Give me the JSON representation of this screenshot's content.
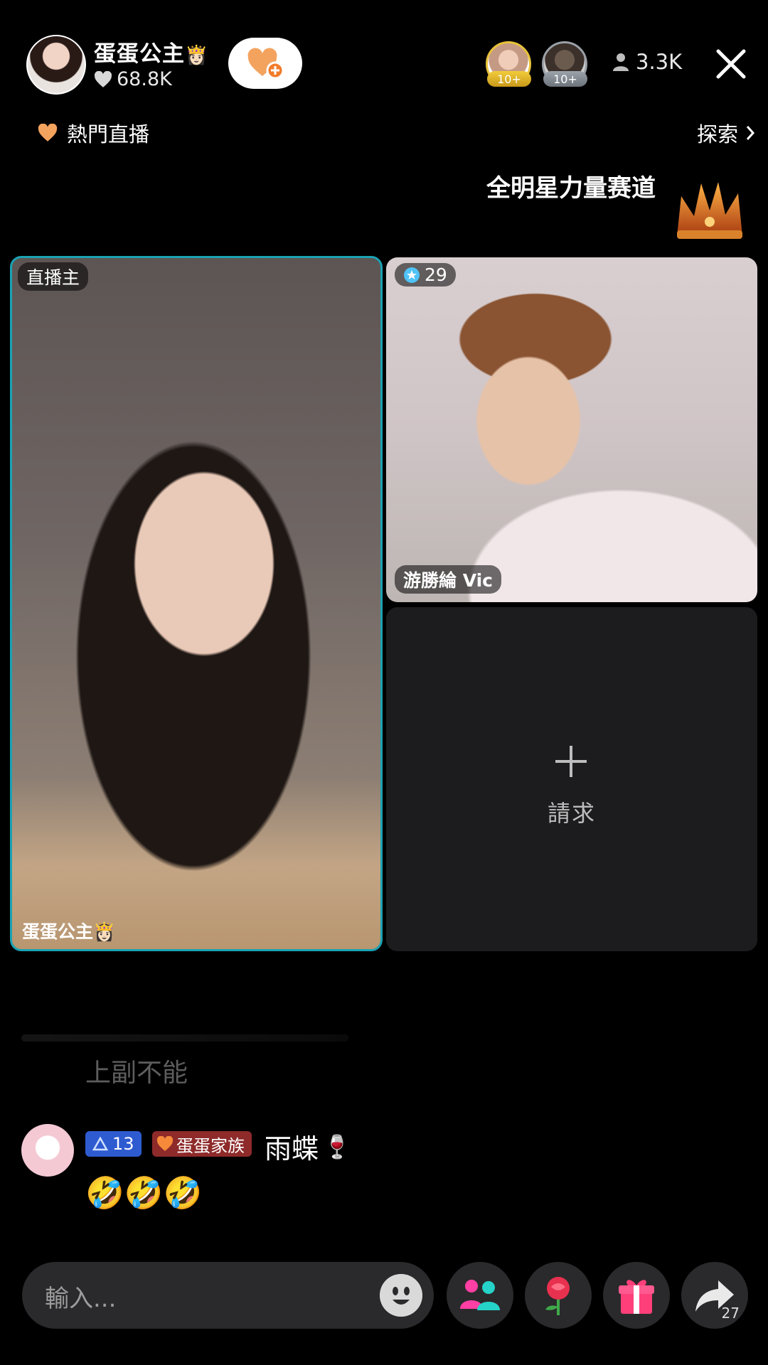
{
  "header": {
    "host_name": "蛋蛋公主",
    "host_emoji": "👸🏻",
    "likes": "68.8K",
    "viewer_badges": [
      "10+",
      "10+"
    ],
    "viewer_count": "3.3K"
  },
  "nav": {
    "hot_live": "熱門直播",
    "explore": "探索"
  },
  "event": {
    "title": "全明星力量赛道"
  },
  "tiles": {
    "host_tag": "直播主",
    "host_name": "蛋蛋公主👸🏻",
    "guest_score": "29",
    "guest_name": "游勝綸 Vic",
    "request_label": "請求"
  },
  "chat": {
    "faded_message": "上副不能",
    "level": "13",
    "family": "蛋蛋家族",
    "username": "雨蝶",
    "username_emoji": "🍷",
    "message": "🤣🤣🤣"
  },
  "bottom": {
    "input_placeholder": "輸入...",
    "share_count": "27"
  },
  "colors": {
    "host_border": "#1aa2b3",
    "level_badge": "#2f5bd1",
    "family_badge": "#8e2a2a",
    "follow_heart": "#f4a35f"
  },
  "icons": [
    "heart-icon",
    "person-icon",
    "close-icon",
    "chevron-right-icon",
    "crown-icon",
    "plus-icon",
    "emoji-icon",
    "multi-guest-icon",
    "rose-icon",
    "gift-icon",
    "share-icon"
  ]
}
